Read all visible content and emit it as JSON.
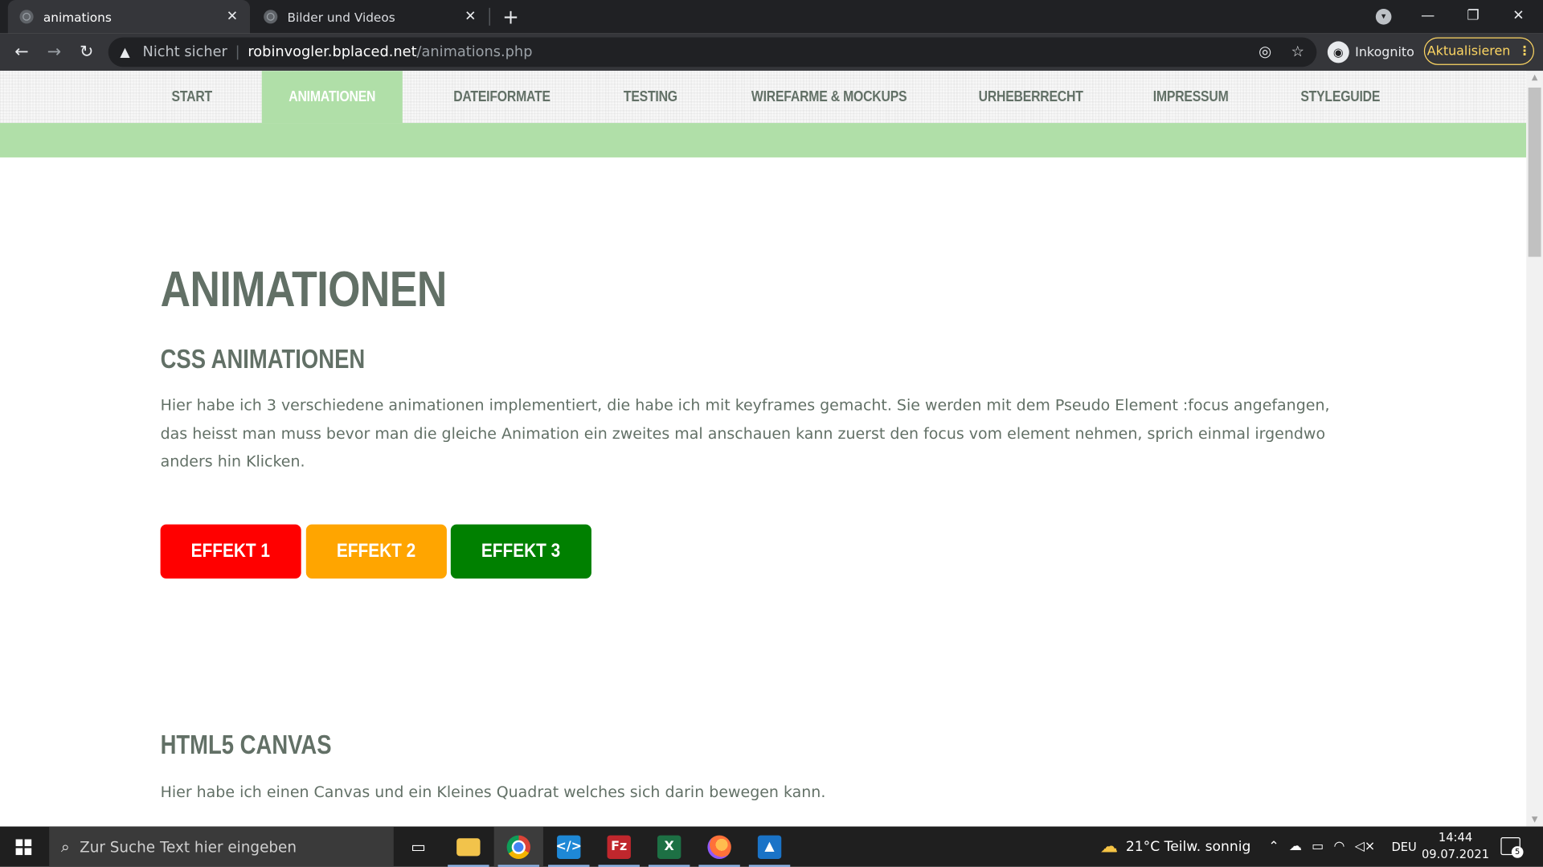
{
  "browser": {
    "tabs": [
      {
        "title": "animations",
        "active": true
      },
      {
        "title": "Bilder und Videos",
        "active": false
      }
    ],
    "new_tab_label": "+",
    "window_controls": {
      "minimize": "—",
      "restore": "❐",
      "close": "✕"
    },
    "address": {
      "security_label": "Nicht sicher",
      "separator": "|",
      "host": "robinvogler.bplaced.net",
      "path": "/animations.php"
    },
    "profile_label": "Inkognito",
    "update_button": "Aktualisieren"
  },
  "site": {
    "nav": [
      {
        "label": "START",
        "active": false
      },
      {
        "label": "ANIMATIONEN",
        "active": true
      },
      {
        "label": "DATEIFORMATE",
        "active": false
      },
      {
        "label": "TESTING",
        "active": false
      },
      {
        "label": "WIREFARME & MOCKUPS",
        "active": false
      },
      {
        "label": "URHEBERRECHT",
        "active": false
      },
      {
        "label": "IMPRESSUM",
        "active": false
      },
      {
        "label": "STYLEGUIDE",
        "active": false
      }
    ],
    "page_title": "ANIMATIONEN",
    "sections": [
      {
        "heading": "CSS ANIMATIONEN",
        "text": "Hier habe ich 3 verschiedene animationen implementiert, die habe ich mit keyframes gemacht. Sie werden mit dem Pseudo Element :focus angefangen, das heisst man muss bevor man die gleiche Animation ein zweites mal anschauen kann zuerst den focus vom element nehmen, sprich einmal irgendwo anders hin Klicken."
      },
      {
        "heading": "HTML5 CANVAS",
        "text": "Hier habe ich einen Canvas und ein Kleines Quadrat welches sich darin bewegen kann."
      }
    ],
    "effect_buttons": [
      {
        "label": "EFFEKT 1",
        "bg": "#ff0000",
        "fg": "#ffffff"
      },
      {
        "label": "EFFEKT 2",
        "bg": "#ffa500",
        "fg": "#ffffff"
      },
      {
        "label": "EFFEKT 3",
        "bg": "#008000",
        "fg": "#ffffff"
      }
    ],
    "colors": {
      "nav_active_bg": "#b0dfa8",
      "text": "#627066",
      "banner": "#b0dfa8"
    }
  },
  "taskbar": {
    "search_placeholder": "Zur Suche Text hier eingeben",
    "apps": [
      "task-view-icon",
      "file-explorer-icon",
      "chrome-icon",
      "vscode-icon",
      "filezilla-icon",
      "excel-icon",
      "firefox-icon",
      "photos-icon"
    ],
    "weather": "21°C  Teilw. sonnig",
    "language": "DEU",
    "time": "14:44",
    "date": "09.07.2021",
    "notification_count": "5"
  }
}
